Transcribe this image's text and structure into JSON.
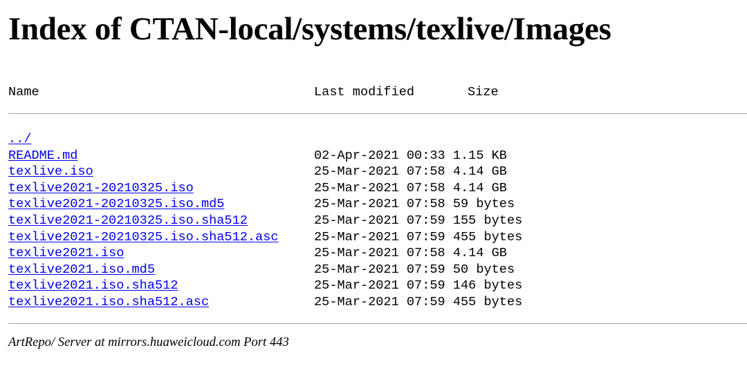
{
  "page": {
    "title": "Index of CTAN-local/systems/texlive/Images"
  },
  "table": {
    "headers": {
      "name": "Name",
      "last_modified": "Last modified",
      "size": "Size"
    },
    "rows": [
      {
        "name": "../",
        "modified": "",
        "size": ""
      },
      {
        "name": "README.md",
        "modified": "02-Apr-2021 00:33",
        "size": "1.15 KB"
      },
      {
        "name": "texlive.iso",
        "modified": "25-Mar-2021 07:58",
        "size": "4.14 GB"
      },
      {
        "name": "texlive2021-20210325.iso",
        "modified": "25-Mar-2021 07:58",
        "size": "4.14 GB"
      },
      {
        "name": "texlive2021-20210325.iso.md5",
        "modified": "25-Mar-2021 07:58",
        "size": "59 bytes"
      },
      {
        "name": "texlive2021-20210325.iso.sha512",
        "modified": "25-Mar-2021 07:59",
        "size": "155 bytes"
      },
      {
        "name": "texlive2021-20210325.iso.sha512.asc",
        "modified": "25-Mar-2021 07:59",
        "size": "455 bytes"
      },
      {
        "name": "texlive2021.iso",
        "modified": "25-Mar-2021 07:58",
        "size": "4.14 GB"
      },
      {
        "name": "texlive2021.iso.md5",
        "modified": "25-Mar-2021 07:59",
        "size": "50 bytes"
      },
      {
        "name": "texlive2021.iso.sha512",
        "modified": "25-Mar-2021 07:59",
        "size": "146 bytes"
      },
      {
        "name": "texlive2021.iso.sha512.asc",
        "modified": "25-Mar-2021 07:59",
        "size": "455 bytes"
      }
    ]
  },
  "footer": {
    "server_text": "ArtRepo/ Server at mirrors.huaweicloud.com Port 443"
  },
  "colors": {
    "link": "#0000ee",
    "rule": "#a0a0a0",
    "text": "#000000",
    "background": "#ffffff"
  }
}
